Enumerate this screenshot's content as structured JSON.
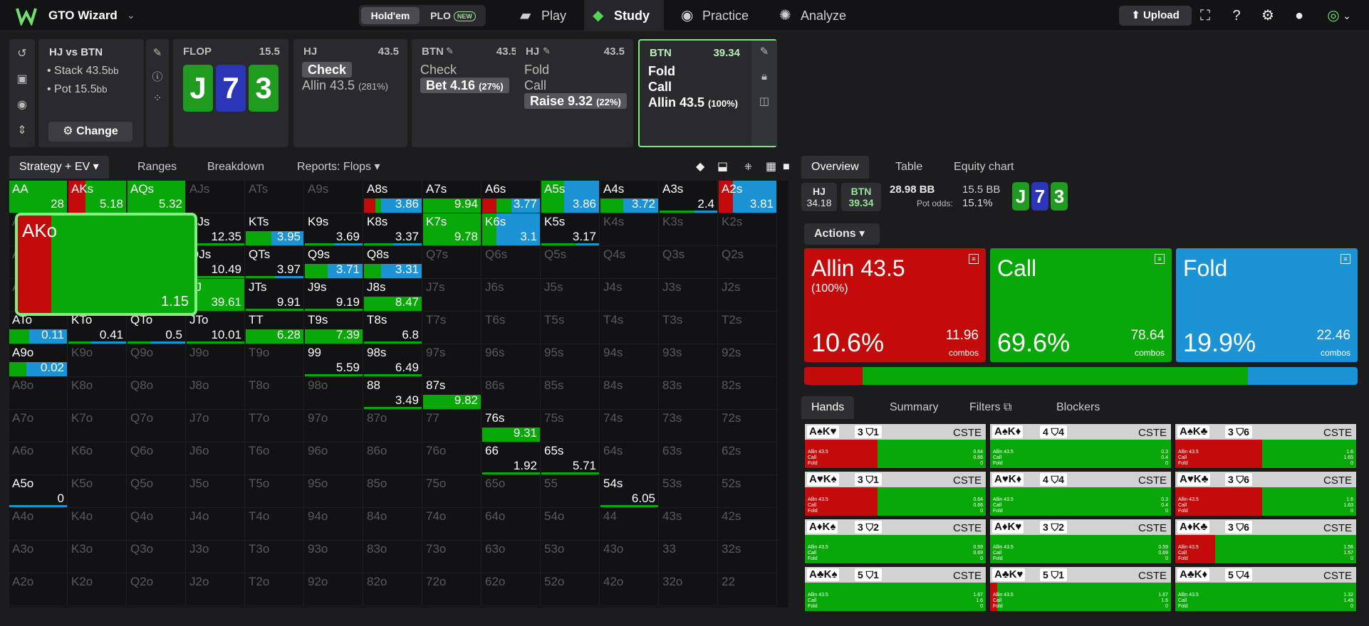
{
  "app": {
    "brand": "GTO Wizard",
    "mode_holdem": "Hold'em",
    "mode_plo": "PLO",
    "new_tag": "NEW",
    "upload": "Upload"
  },
  "nav": {
    "play": "Play",
    "study": "Study",
    "practice": "Practice",
    "analyze": "Analyze"
  },
  "game": {
    "title": "HJ vs BTN",
    "stack_label": "Stack 43.5",
    "stack_unit": "bb",
    "pot_label": "Pot 15.5",
    "pot_unit": "bb",
    "change": "Change"
  },
  "flop_panel": {
    "title": "FLOP",
    "pot": "15.5",
    "cards": [
      {
        "rank": "J",
        "color": "#1f9b1f"
      },
      {
        "rank": "7",
        "color": "#2a35b8"
      },
      {
        "rank": "3",
        "color": "#1f9b1f"
      }
    ]
  },
  "history": [
    {
      "pos": "HJ",
      "stack": "43.5",
      "actions": [
        {
          "label": "Check",
          "selected": true,
          "pct": ""
        },
        {
          "label": "Allin 43.5",
          "pct": "(281%)",
          "selected": false
        }
      ]
    },
    {
      "pos": "BTN",
      "stack": "43.5",
      "actions": [
        {
          "label": "Check",
          "selected": false,
          "pct": ""
        },
        {
          "label": "Bet 4.16",
          "pct": "(27%)",
          "selected": true
        }
      ]
    },
    {
      "pos": "HJ",
      "stack": "43.5",
      "actions": [
        {
          "label": "Fold",
          "selected": false,
          "pct": ""
        },
        {
          "label": "Call",
          "selected": false,
          "pct": ""
        },
        {
          "label": "Raise 9.32",
          "pct": "(22%)",
          "selected": true
        }
      ]
    },
    {
      "pos": "BTN",
      "stack": "39.34",
      "actions": [
        {
          "label": "Fold",
          "pct": ""
        },
        {
          "label": "Call",
          "pct": ""
        },
        {
          "label": "Allin 43.5",
          "pct": "(100%)"
        }
      ]
    }
  ],
  "left_tabs": {
    "strategy": "Strategy + EV",
    "ranges": "Ranges",
    "breakdown": "Breakdown",
    "reports": "Reports: Flops"
  },
  "right_tabs": {
    "overview": "Overview",
    "table": "Table",
    "equity": "Equity chart"
  },
  "matrix": {
    "ranks": [
      "A",
      "K",
      "Q",
      "J",
      "T",
      "9",
      "8",
      "7",
      "6",
      "5",
      "4",
      "3",
      "2"
    ],
    "cells": {
      "AA": {
        "v": "28",
        "a": 0,
        "c": 100,
        "f": 0,
        "full": true
      },
      "AKs": {
        "v": "5.18",
        "a": 30,
        "c": 70,
        "f": 0,
        "full": true
      },
      "AQs": {
        "v": "5.32",
        "a": 0,
        "c": 100,
        "f": 0,
        "full": true
      },
      "A8s": {
        "v": "3.86",
        "a": 20,
        "c": 10,
        "f": 70
      },
      "A7s": {
        "v": "9.94",
        "a": 0,
        "c": 100,
        "f": 0
      },
      "A6s": {
        "v": "3.77",
        "a": 25,
        "c": 25,
        "f": 50
      },
      "A5s": {
        "v": "3.86",
        "a": 0,
        "c": 40,
        "f": 60,
        "full": true
      },
      "A4s": {
        "v": "3.72",
        "a": 0,
        "c": 40,
        "f": 60
      },
      "A3s": {
        "v": "2.4",
        "a": 0,
        "c": 60,
        "f": 40,
        "thin": true
      },
      "A2s": {
        "v": "3.81",
        "a": 25,
        "c": 0,
        "f": 75,
        "full": true
      },
      "KJs": {
        "v": "12.35",
        "a": 0,
        "c": 100,
        "f": 0,
        "thin": true
      },
      "KTs": {
        "v": "3.95",
        "a": 0,
        "c": 45,
        "f": 55
      },
      "K9s": {
        "v": "3.69",
        "a": 0,
        "c": 50,
        "f": 50,
        "thin": true
      },
      "K8s": {
        "v": "3.37",
        "a": 0,
        "c": 50,
        "f": 50,
        "thin": true
      },
      "K7s": {
        "v": "9.78",
        "a": 0,
        "c": 100,
        "f": 0,
        "full": true
      },
      "K6s": {
        "v": "3.1",
        "a": 0,
        "c": 25,
        "f": 75,
        "full": true
      },
      "K5s": {
        "v": "3.17",
        "a": 0,
        "c": 60,
        "f": 40,
        "thin": true
      },
      "QJs": {
        "v": "10.49",
        "a": 0,
        "c": 100,
        "f": 0,
        "thin": true
      },
      "QTs": {
        "v": "3.97",
        "a": 0,
        "c": 50,
        "f": 50,
        "thin": true
      },
      "Q9s": {
        "v": "3.71",
        "a": 0,
        "c": 40,
        "f": 60
      },
      "Q8s": {
        "v": "3.31",
        "a": 0,
        "c": 30,
        "f": 70
      },
      "JJ": {
        "v": "39.61",
        "a": 0,
        "c": 100,
        "f": 0,
        "full": true
      },
      "JTs": {
        "v": "9.91",
        "a": 0,
        "c": 100,
        "f": 0,
        "thin": true
      },
      "J9s": {
        "v": "9.19",
        "a": 0,
        "c": 100,
        "f": 0,
        "thin": true
      },
      "J8s": {
        "v": "8.47",
        "a": 0,
        "c": 100,
        "f": 0
      },
      "ATo": {
        "v": "0.11",
        "a": 0,
        "c": 35,
        "f": 65
      },
      "KTo": {
        "v": "0.41",
        "a": 0,
        "c": 40,
        "f": 60,
        "thin": true
      },
      "QTo": {
        "v": "0.5",
        "a": 0,
        "c": 40,
        "f": 60,
        "thin": true
      },
      "JTo": {
        "v": "10.01",
        "a": 0,
        "c": 100,
        "f": 0,
        "thin": true
      },
      "TT": {
        "v": "6.28",
        "a": 0,
        "c": 100,
        "f": 0
      },
      "T9s": {
        "v": "7.39",
        "a": 0,
        "c": 100,
        "f": 0
      },
      "T8s": {
        "v": "6.8",
        "a": 0,
        "c": 100,
        "f": 0,
        "thin": true
      },
      "A9o": {
        "v": "0.02",
        "a": 0,
        "c": 30,
        "f": 70
      },
      "99": {
        "v": "5.59",
        "a": 0,
        "c": 100,
        "f": 0,
        "thin": true
      },
      "98s": {
        "v": "6.49",
        "a": 0,
        "c": 100,
        "f": 0,
        "thin": true
      },
      "88": {
        "v": "3.49",
        "a": 0,
        "c": 100,
        "f": 0,
        "thin": true
      },
      "87s": {
        "v": "9.82",
        "a": 0,
        "c": 100,
        "f": 0
      },
      "76s": {
        "v": "9.31",
        "a": 0,
        "c": 100,
        "f": 0
      },
      "66": {
        "v": "1.92",
        "a": 0,
        "c": 100,
        "f": 0,
        "thin": true
      },
      "65s": {
        "v": "5.71",
        "a": 0,
        "c": 100,
        "f": 0,
        "thin": true
      },
      "54s": {
        "v": "6.05",
        "a": 0,
        "c": 100,
        "f": 0,
        "thin": true
      },
      "A5o": {
        "v": "0",
        "a": 0,
        "c": 0,
        "f": 100,
        "thin": true
      }
    },
    "zoom": {
      "hand": "AKo",
      "v": "1.15",
      "a": 19,
      "c": 81
    }
  },
  "overview": {
    "hj_label": "HJ",
    "hj_stack": "34.18",
    "btn_label": "BTN",
    "btn_stack": "39.34",
    "pot": "28.98 BB",
    "pot_bb": "15.5 BB",
    "pot_odds_label": "Pot odds:",
    "pot_odds": "15.1%",
    "actions_label": "Actions",
    "cards": [
      {
        "name": "Allin 43.5",
        "sub": "(100%)",
        "pct": "10.6%",
        "combos": "11.96",
        "combos_label": "combos",
        "color": "#c30b0b"
      },
      {
        "name": "Call",
        "sub": "",
        "pct": "69.6%",
        "combos": "78.64",
        "combos_label": "combos",
        "color": "#08a808"
      },
      {
        "name": "Fold",
        "sub": "",
        "pct": "19.9%",
        "combos": "22.46",
        "combos_label": "combos",
        "color": "#1b93d4"
      }
    ],
    "freq": [
      10.6,
      69.6,
      19.9
    ]
  },
  "hands_tabs": {
    "hands": "Hands",
    "summary": "Summary",
    "filters": "Filters",
    "blockers": "Blockers"
  },
  "hands": [
    {
      "cards": "A♠K♥",
      "blk": "3 ⛉1",
      "r": 40,
      "ev": [
        "0.64",
        "0.66",
        "0"
      ]
    },
    {
      "cards": "A♠K♦",
      "blk": "4 ⛉4",
      "r": 0,
      "ev": [
        "0.3",
        "0.4",
        "0"
      ]
    },
    {
      "cards": "A♠K♣",
      "blk": "3 ⛉6",
      "r": 48,
      "ev": [
        "1.6",
        "1.65",
        "0"
      ]
    },
    {
      "cards": "A♥K♠",
      "blk": "3 ⛉1",
      "r": 40,
      "ev": [
        "0.64",
        "0.66",
        "0"
      ]
    },
    {
      "cards": "A♥K♦",
      "blk": "4 ⛉4",
      "r": 0,
      "ev": [
        "0.3",
        "0.4",
        "0"
      ]
    },
    {
      "cards": "A♥K♣",
      "blk": "3 ⛉6",
      "r": 48,
      "ev": [
        "1.6",
        "1.63",
        "0"
      ]
    },
    {
      "cards": "A♦K♠",
      "blk": "3 ⛉2",
      "r": 0,
      "ev": [
        "0.59",
        "0.69",
        "0"
      ]
    },
    {
      "cards": "A♦K♥",
      "blk": "3 ⛉2",
      "r": 0,
      "ev": [
        "0.59",
        "0.69",
        "0"
      ]
    },
    {
      "cards": "A♦K♣",
      "blk": "3 ⛉6",
      "r": 22,
      "ev": [
        "1.56",
        "1.57",
        "0"
      ]
    },
    {
      "cards": "A♣K♠",
      "blk": "5 ⛉1",
      "r": 0,
      "ev": [
        "1.67",
        "1.6",
        "0"
      ]
    },
    {
      "cards": "A♣K♥",
      "blk": "5 ⛉1",
      "r": 4,
      "ev": [
        "1.67",
        "1.6",
        "0"
      ]
    },
    {
      "cards": "A♣K♦",
      "blk": "5 ⛉4",
      "r": 0,
      "ev": [
        "1.32",
        "1.49",
        "0"
      ]
    }
  ],
  "hand_cste": "CSTE",
  "hand_lines": [
    "Allin 43.5",
    "Call",
    "Fold"
  ],
  "colors": {
    "allin": "#c30b0b",
    "call": "#08a808",
    "fold": "#1b93d4",
    "accent": "#7fe37f"
  }
}
